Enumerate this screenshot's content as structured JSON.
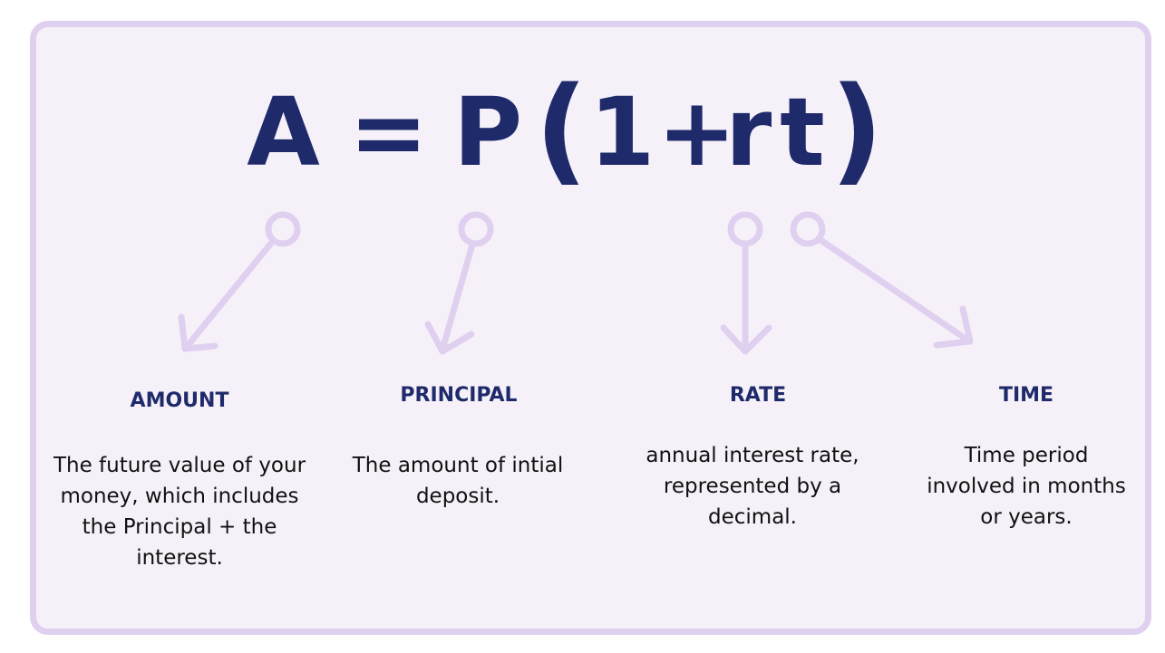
{
  "formula": {
    "A": "A",
    "eq": "=",
    "P": "P",
    "lparen": "(",
    "one": "1",
    "plus": "+",
    "r": "r",
    "t": "t",
    "rparen": ")"
  },
  "terms": [
    {
      "label": "AMOUNT",
      "description": "The future value of your money, which includes the Principal + the interest."
    },
    {
      "label": "PRINCIPAL",
      "description": "The amount of intial deposit."
    },
    {
      "label": "RATE",
      "description": "annual interest rate, represented by a decimal."
    },
    {
      "label": "TIME",
      "description": "Time period involved in months or years."
    }
  ],
  "colors": {
    "formula_text": "#1f2a6b",
    "card_background": "#f6f1f9",
    "card_border": "#e0d0f0",
    "arrow": "#e0d0f0"
  }
}
